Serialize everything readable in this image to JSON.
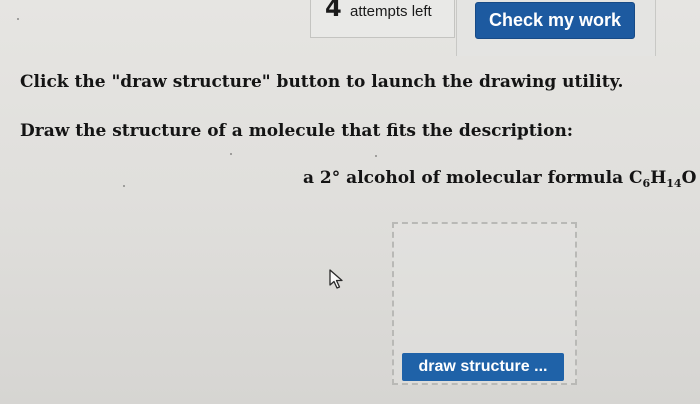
{
  "toolbar": {
    "attempts_count": "4",
    "attempts_label": "attempts left",
    "check_button_label": "Check my work"
  },
  "question": {
    "instruction": "Click the \"draw structure\" button to launch the drawing utility.",
    "prompt": "Draw the structure of a molecule that fits the description:",
    "description_prefix": "a 2° alcohol of molecular formula C",
    "formula_c_count": "6",
    "formula_h": "H",
    "formula_h_count": "14",
    "formula_o": "O"
  },
  "drawing": {
    "draw_button_label": "draw structure ..."
  },
  "colors": {
    "accent": "#1d5aa0",
    "background": "#e2e1de"
  },
  "icons": {
    "pointer": "arrow-cursor-icon"
  }
}
